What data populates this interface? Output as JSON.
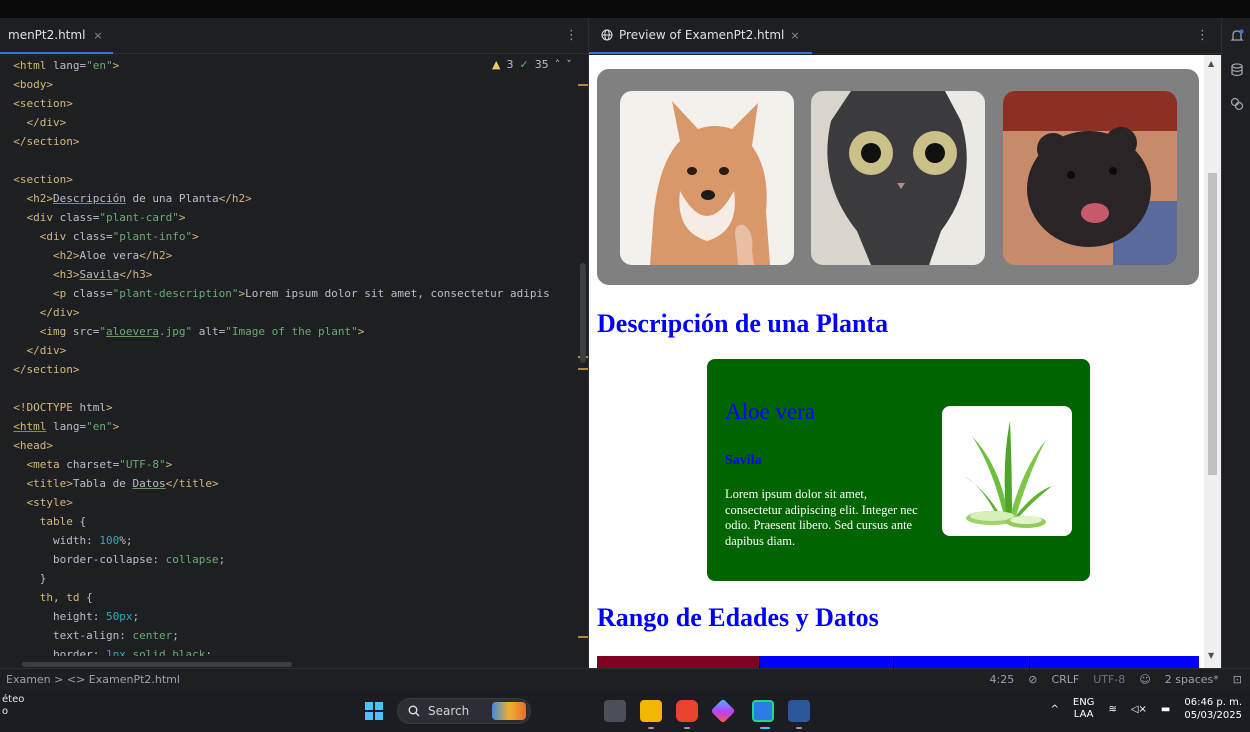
{
  "editor": {
    "tab_label": "menPt2.html",
    "tab_close": "×",
    "menu_glyph": "⋮",
    "inspections": {
      "warnings": "3",
      "checks": "35"
    },
    "lines": [
      [
        [
          "tag",
          "<html "
        ],
        [
          "attr",
          "lang="
        ],
        [
          "val",
          "\"en\""
        ],
        [
          "tag",
          ">"
        ]
      ],
      [
        [
          "tag",
          "<body>"
        ]
      ],
      [
        [
          "tag",
          "<section>"
        ]
      ],
      [
        [
          "txt",
          "  "
        ],
        [
          "tag",
          "</div>"
        ]
      ],
      [
        [
          "tag",
          "</section>"
        ]
      ],
      [
        [
          "txt",
          ""
        ]
      ],
      [
        [
          "tag",
          "<section>"
        ]
      ],
      [
        [
          "txt",
          "  "
        ],
        [
          "tag",
          "<h2>"
        ],
        [
          "ul",
          "Descripción"
        ],
        [
          "txt",
          " de una Planta"
        ],
        [
          "tag",
          "</h2>"
        ]
      ],
      [
        [
          "txt",
          "  "
        ],
        [
          "tag",
          "<div "
        ],
        [
          "attr",
          "class="
        ],
        [
          "val",
          "\"plant-card\""
        ],
        [
          "tag",
          ">"
        ]
      ],
      [
        [
          "txt",
          "    "
        ],
        [
          "tag",
          "<div "
        ],
        [
          "attr",
          "class="
        ],
        [
          "val",
          "\"plant-info\""
        ],
        [
          "tag",
          ">"
        ]
      ],
      [
        [
          "txt",
          "      "
        ],
        [
          "tag",
          "<h2>"
        ],
        [
          "txt",
          "Aloe vera"
        ],
        [
          "tag",
          "</h2>"
        ]
      ],
      [
        [
          "txt",
          "      "
        ],
        [
          "tag",
          "<h3>"
        ],
        [
          "ul",
          "Savila"
        ],
        [
          "tag",
          "</h3>"
        ]
      ],
      [
        [
          "txt",
          "      "
        ],
        [
          "tag",
          "<p "
        ],
        [
          "attr",
          "class="
        ],
        [
          "val",
          "\"plant-description\""
        ],
        [
          "tag",
          ">"
        ],
        [
          "txt",
          "Lorem ipsum dolor sit amet, consectetur adipis"
        ]
      ],
      [
        [
          "txt",
          "    "
        ],
        [
          "tag",
          "</div>"
        ]
      ],
      [
        [
          "txt",
          "    "
        ],
        [
          "tag",
          "<img "
        ],
        [
          "attr",
          "src="
        ],
        [
          "val",
          "\""
        ],
        [
          "valul",
          "aloevera"
        ],
        [
          "val",
          ".jpg\""
        ],
        [
          "attr",
          " alt="
        ],
        [
          "val",
          "\"Image of the plant\""
        ],
        [
          "tag",
          ">"
        ]
      ],
      [
        [
          "txt",
          "  "
        ],
        [
          "tag",
          "</div>"
        ]
      ],
      [
        [
          "tag",
          "</section>"
        ]
      ],
      [
        [
          "txt",
          ""
        ]
      ],
      [
        [
          "tag",
          "<!DOCTYPE "
        ],
        [
          "attr",
          "html"
        ],
        [
          "tag",
          ">"
        ]
      ],
      [
        [
          "tagul",
          "<html"
        ],
        [
          "attr",
          " lang="
        ],
        [
          "val",
          "\"en\""
        ],
        [
          "tag",
          ">"
        ]
      ],
      [
        [
          "tag",
          "<head>"
        ]
      ],
      [
        [
          "txt",
          "  "
        ],
        [
          "tag",
          "<meta "
        ],
        [
          "attr",
          "charset="
        ],
        [
          "val",
          "\"UTF-8\""
        ],
        [
          "tag",
          ">"
        ]
      ],
      [
        [
          "txt",
          "  "
        ],
        [
          "tag",
          "<title>"
        ],
        [
          "txt",
          "Tabla de "
        ],
        [
          "ul",
          "Datos"
        ],
        [
          "tag",
          "</title>"
        ]
      ],
      [
        [
          "txt",
          "  "
        ],
        [
          "tag",
          "<style>"
        ]
      ],
      [
        [
          "txt",
          "    "
        ],
        [
          "tag",
          "table"
        ],
        [
          "txt",
          " {"
        ]
      ],
      [
        [
          "txt",
          "      width: "
        ],
        [
          "num",
          "100"
        ],
        [
          "txt",
          "%;"
        ]
      ],
      [
        [
          "txt",
          "      border-collapse: "
        ],
        [
          "val",
          "collapse"
        ],
        [
          "txt",
          ";"
        ]
      ],
      [
        [
          "txt",
          "    }"
        ]
      ],
      [
        [
          "txt",
          "    "
        ],
        [
          "tag",
          "th"
        ],
        [
          "txt",
          ", "
        ],
        [
          "tag",
          "td"
        ],
        [
          "txt",
          " {"
        ]
      ],
      [
        [
          "txt",
          "      height: "
        ],
        [
          "num",
          "50px"
        ],
        [
          "txt",
          ";"
        ]
      ],
      [
        [
          "txt",
          "      text-align: "
        ],
        [
          "val",
          "center"
        ],
        [
          "txt",
          ";"
        ]
      ],
      [
        [
          "txt",
          "      border: "
        ],
        [
          "num",
          "1px"
        ],
        [
          "val",
          " solid black"
        ],
        [
          "txt",
          ";"
        ]
      ]
    ]
  },
  "preview": {
    "tab_label": "Preview of ExamenPt2.html",
    "tab_close": "×",
    "menu_glyph": "⋮",
    "heading_plant": "Descripción de una Planta",
    "plant_name": "Aloe vera",
    "plant_common": "Savila",
    "plant_desc": "Lorem ipsum dolor sit amet, consectetur adipiscing elit. Integer nec odio. Praesent libero. Sed cursus ante dapibus diam.",
    "heading_ages": "Rango de Edades y Datos",
    "photos": [
      "dog photo",
      "cat photo",
      "rat photo"
    ]
  },
  "status": {
    "breadcrumb": "Examen  >  <> ExamenPt2.html",
    "position": "4:25",
    "line_sep": "CRLF",
    "encoding": "UTF-8",
    "indent": "2 spaces*"
  },
  "taskbar": {
    "weather_line1": "éteo",
    "weather_line2": "o",
    "search_placeholder": "Search",
    "lang_line1": "ENG",
    "lang_line2": "LAA",
    "time": "06:46 p. m.",
    "date": "05/03/2025"
  },
  "colors": {
    "accent": "#3574f0",
    "heading_blue": "#0000ff",
    "card_green": "#006400",
    "gallery_gray": "#808080"
  }
}
